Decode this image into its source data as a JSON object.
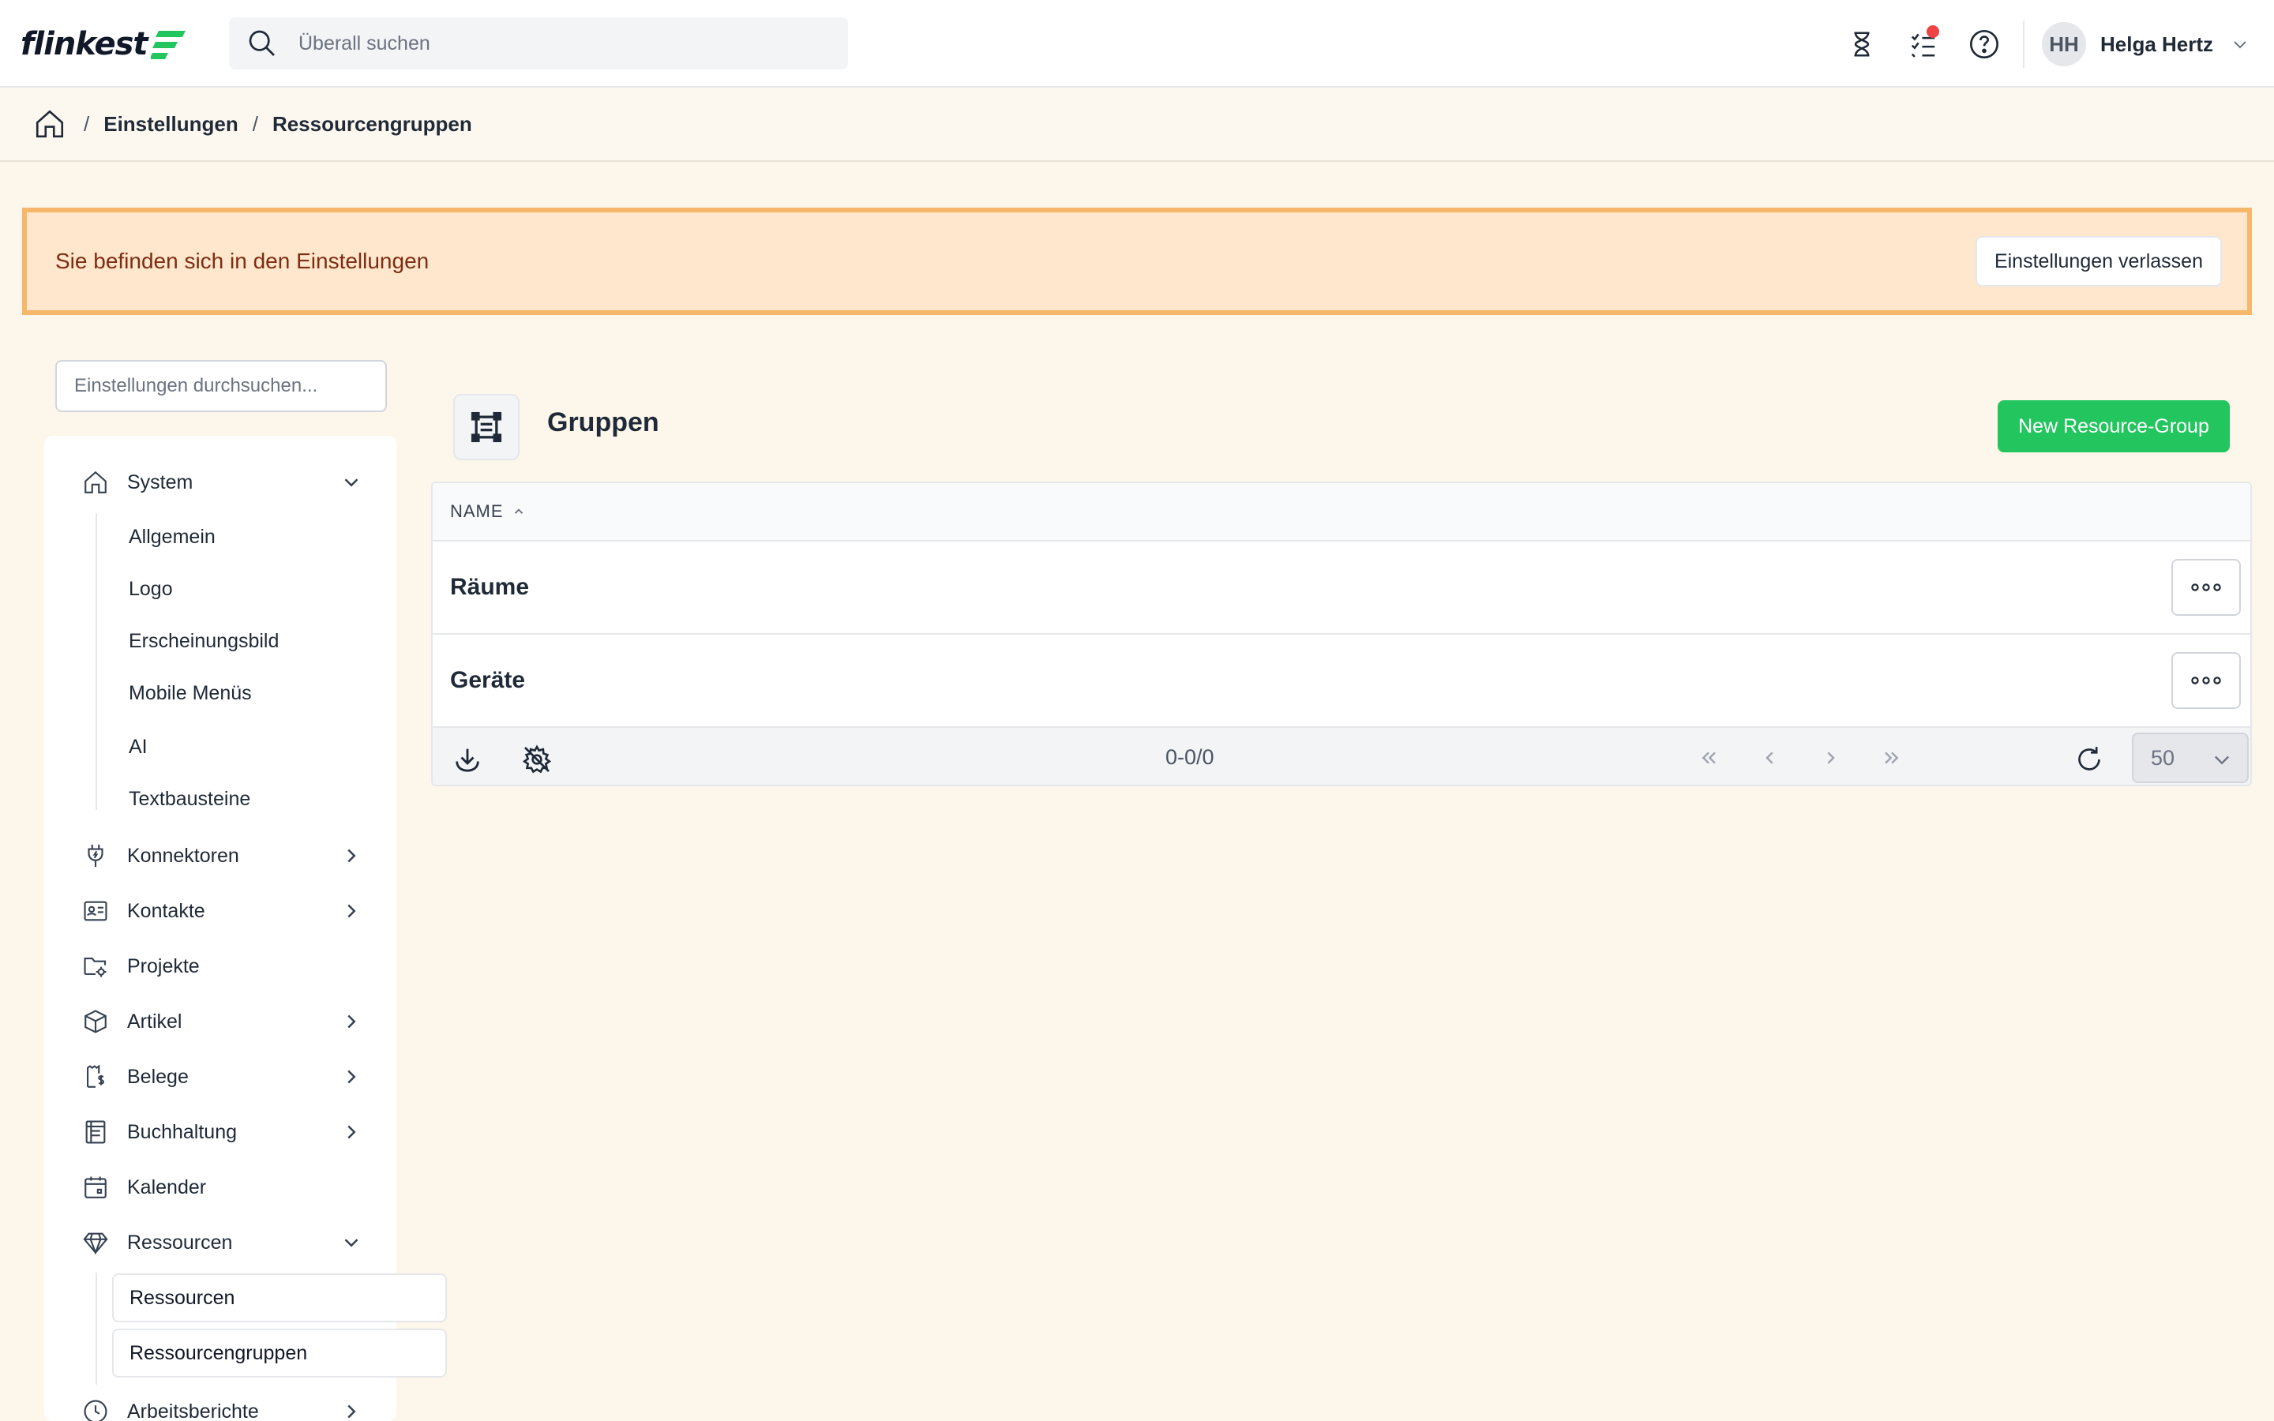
{
  "header": {
    "logo_text": "flinkest",
    "brand_color": "#22c55e",
    "search_placeholder": "Überall suchen",
    "user": {
      "initials": "HH",
      "name": "Helga Hertz"
    },
    "icons": [
      "search-icon",
      "hourglass-icon",
      "tasks-icon",
      "help-icon",
      "chevron-down-icon"
    ]
  },
  "breadcrumb": {
    "separator": "/",
    "items": [
      "Einstellungen",
      "Ressourcengruppen"
    ]
  },
  "banner": {
    "text": "Sie befinden sich in den Einstellungen",
    "button": "Einstellungen verlassen",
    "background": "#ffe7cd",
    "border": "#f6b76a"
  },
  "sidebar": {
    "search_placeholder": "Einstellungen durchsuchen...",
    "items": [
      {
        "label": "System",
        "icon": "home-icon",
        "expanded": true
      },
      {
        "label": "Konnektoren",
        "icon": "plug-icon"
      },
      {
        "label": "Kontakte",
        "icon": "contact-card-icon"
      },
      {
        "label": "Projekte",
        "icon": "folder-gear-icon"
      },
      {
        "label": "Artikel",
        "icon": "box-icon"
      },
      {
        "label": "Belege",
        "icon": "receipt-icon"
      },
      {
        "label": "Buchhaltung",
        "icon": "ledger-icon"
      },
      {
        "label": "Kalender",
        "icon": "calendar-icon"
      },
      {
        "label": "Ressourcen",
        "icon": "gem-icon",
        "expanded": true
      },
      {
        "label": "Arbeitsberichte",
        "icon": "clock-icon"
      }
    ],
    "system_children": [
      "Allgemein",
      "Logo",
      "Erscheinungsbild",
      "Mobile Menüs",
      "AI",
      "Textbausteine"
    ],
    "ressourcen_children": [
      "Ressourcen",
      "Ressourcengruppen"
    ]
  },
  "main": {
    "title": "Gruppen",
    "new_button": "New Resource-Group",
    "new_button_color": "#22c55e",
    "table": {
      "column": "NAME",
      "sort": "ascending",
      "rows": [
        {
          "name": "Räume"
        },
        {
          "name": "Geräte"
        }
      ]
    },
    "footer": {
      "range": "0-0/0",
      "page_size": "50"
    }
  }
}
